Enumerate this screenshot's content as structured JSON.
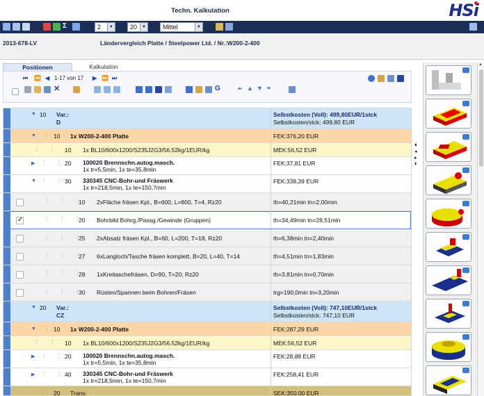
{
  "app": {
    "title": "Techn. Kalkulation",
    "logo": "HSi"
  },
  "toolbar": {
    "select_1": "2",
    "select_2": "20",
    "select_3": "Mittel"
  },
  "subheader": {
    "ref_no": "2013-678-LV",
    "doc_title": "Ländervergleich Platte / Steelpower Ltd. / Nr.:W200-2-400"
  },
  "tabs": [
    {
      "label": "Positionen"
    },
    {
      "label": "Kalkulation"
    }
  ],
  "paging": {
    "text": "1-17 von 17"
  },
  "rows": [
    {
      "kind": "var",
      "num": "10",
      "title": "Var.:",
      "sub": "D",
      "right_bold": "Selbstkosten (Voll): 499,80EUR/1stck",
      "right": "Selbstkosten/stck: 499,80 EUR"
    },
    {
      "kind": "org",
      "num": "10",
      "title": "1x W200-2-400 Platte",
      "right": "FEK:376,20 EUR"
    },
    {
      "kind": "yel",
      "num": "10",
      "title": "1x BL10/600x1200/S235J2G3/56.52kg/1EUR/kg",
      "right": "MEK:56,52 EUR"
    },
    {
      "kind": "wht",
      "num": "20",
      "title": "100020 Brennschn.autog.masch.",
      "sub": "1x tr=5,5min, 1x te=35,8min",
      "right": "FEK:37,81 EUR"
    },
    {
      "kind": "wht",
      "num": "30",
      "title": "330345 CNC-Bohr-und Fräswerk",
      "sub": "1x tr=218,5min, 1x te=150,7min",
      "right": "FEK:338,39 EUR"
    },
    {
      "kind": "gry",
      "num": "10",
      "title": "2xFläche fräsen Kpl., B=600, L=800, T=4, Rz20",
      "right": "th=40,21min tn=2,00min"
    },
    {
      "kind": "sel",
      "num": "20",
      "title": "Bohrbild Bohrg./Passg./Gewinde (Gruppen)",
      "right": "th=34,49min tn=28,51min"
    },
    {
      "kind": "gry",
      "num": "25",
      "title": "2xAbsatz fräsen Kpl., B=60, L=200, T=18, Rz20",
      "right": "th=6,38min tn=2,40min"
    },
    {
      "kind": "gry",
      "num": "27",
      "title": "6xLangloch/Tasche fräsen komplett, B=20, L=40, T=14",
      "right": "th=4,51min tn=1,83min"
    },
    {
      "kind": "gry",
      "num": "28",
      "title": "1xKreitaschefräsen, D=90, T=20, Rz20",
      "right": "th=3,81min tn=0,70min"
    },
    {
      "kind": "gry",
      "num": "30",
      "title": "Rüsten/Spannen beim Bohren/Fräsen",
      "right": "trg=190,0min tn=3,20min"
    },
    {
      "kind": "var",
      "num": "20",
      "title": "Var.:",
      "sub": "CZ",
      "right_bold": "Selbstkosten (Voll): 747,10EUR/1stck",
      "right": "Selbstkosten/stck: 747,10 EUR"
    },
    {
      "kind": "org",
      "num": "10",
      "title": "1x W200-2-400 Platte",
      "right": "FEK:287,29 EUR"
    },
    {
      "kind": "yel",
      "num": "10",
      "title": "1x BL10/600x1200/S235J2G3/56.52kg/1EUR/kg",
      "right": "MEK:56,52 EUR"
    },
    {
      "kind": "wht",
      "num": "20",
      "title": "100020 Brennschn.autog.masch.",
      "sub": "1x tr=5,5min, 1x te=35,8min",
      "right": "FEK:28,88 EUR"
    },
    {
      "kind": "wht",
      "num": "40",
      "title": "330345 CNC-Bohr-und Fräswerk",
      "sub": "1x tr=218,5min, 1x te=150,7min",
      "right": "FEK:258,41 EUR"
    },
    {
      "kind": "olive",
      "num": "20",
      "title": "Trans;",
      "right": "SEK:350,00 EUR"
    }
  ],
  "colors": {
    "toolbar_bg": "#1c2f57",
    "var_row": "#cde5f7",
    "org_row": "#fbd6a6",
    "yel_row": "#fdf6c9",
    "olive_row": "#d3c07c",
    "accent": "#2b63d3"
  }
}
